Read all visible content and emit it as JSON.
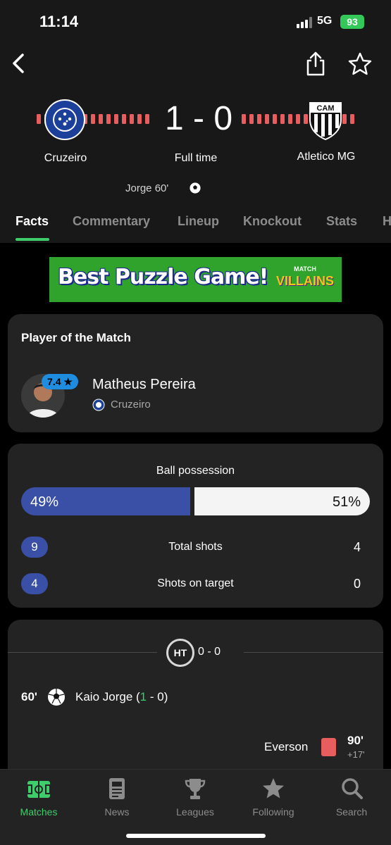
{
  "status_bar": {
    "time": "11:14",
    "network": "5G",
    "battery": "93"
  },
  "header": {
    "home_team": "Cruzeiro",
    "away_team": "Atletico MG",
    "score": "1 - 0",
    "match_status": "Full time",
    "scorer_line": "Jorge 60'",
    "away_crest_text": "CAM"
  },
  "tabs": [
    {
      "label": "Facts",
      "active": true
    },
    {
      "label": "Commentary"
    },
    {
      "label": "Lineup"
    },
    {
      "label": "Knockout"
    },
    {
      "label": "Stats"
    },
    {
      "label": "H"
    }
  ],
  "ad": {
    "headline": "Best Puzzle Game!",
    "logo_top": "MATCH",
    "logo_main": "VILLAINS"
  },
  "player_of_match": {
    "title": "Player of the Match",
    "rating": "7.4",
    "name": "Matheus Pereira",
    "team": "Cruzeiro"
  },
  "stats": {
    "possession_label": "Ball possession",
    "possession_home": "49%",
    "possession_away": "51%",
    "possession_home_fraction": 0.49,
    "rows": [
      {
        "label": "Total shots",
        "home": "9",
        "away": "4"
      },
      {
        "label": "Shots on target",
        "home": "4",
        "away": "0"
      }
    ]
  },
  "events": {
    "ht_label": "HT",
    "ht_score": "0 - 0",
    "goal": {
      "minute": "60'",
      "player": "Kaio Jorge",
      "open": " (",
      "score_home": "1",
      "score_rest": " - 0)"
    },
    "card": {
      "player": "Everson",
      "minute": "90'",
      "added": "+17'"
    }
  },
  "tabbar": [
    {
      "label": "Matches",
      "icon": "pitch-icon",
      "active": true
    },
    {
      "label": "News",
      "icon": "news-icon"
    },
    {
      "label": "Leagues",
      "icon": "trophy-icon"
    },
    {
      "label": "Following",
      "icon": "star-icon"
    },
    {
      "label": "Search",
      "icon": "search-icon"
    }
  ],
  "colors": {
    "accent": "#3fcd6b",
    "home": "#3a4fa6",
    "card_red": "#e85d5d",
    "rating": "#1e8de0"
  }
}
